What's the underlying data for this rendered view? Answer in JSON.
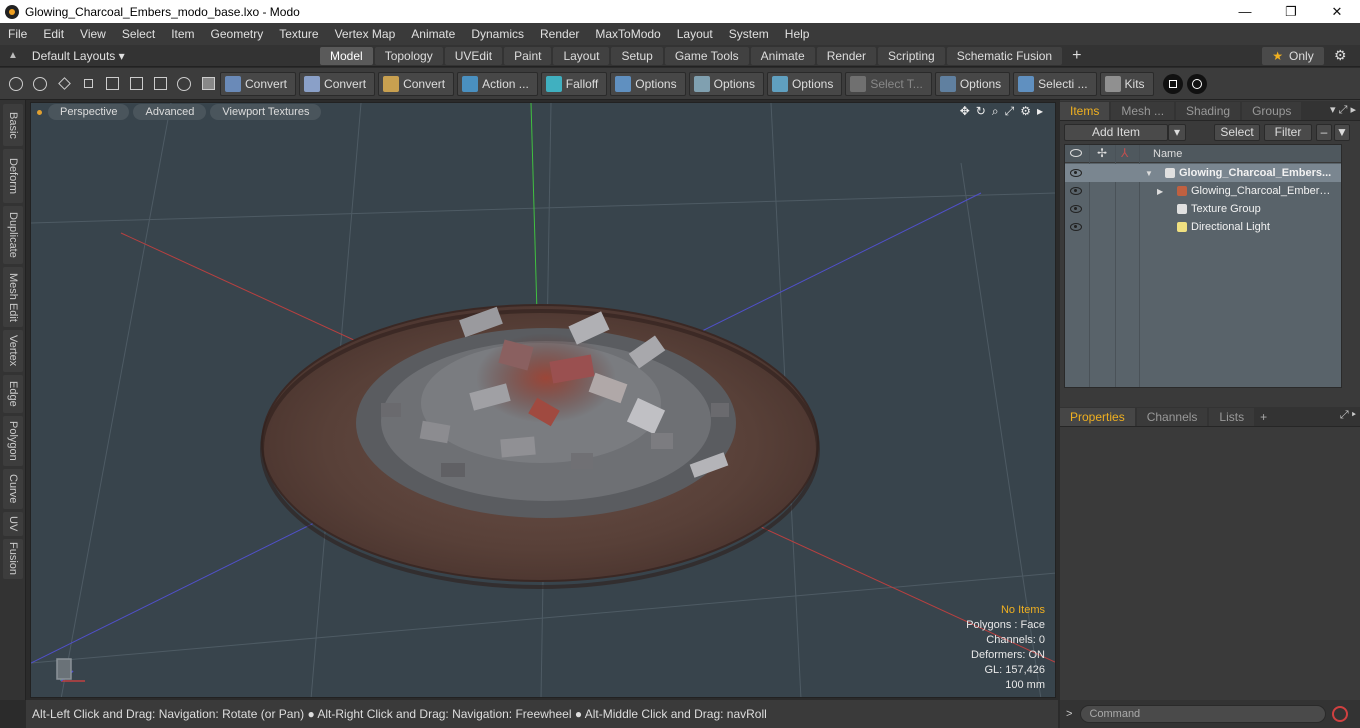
{
  "window": {
    "title": "Glowing_Charcoal_Embers_modo_base.lxo - Modo",
    "minimize": "—",
    "maximize": "❐",
    "close": "✕"
  },
  "menu": [
    "File",
    "Edit",
    "View",
    "Select",
    "Item",
    "Geometry",
    "Texture",
    "Vertex Map",
    "Animate",
    "Dynamics",
    "Render",
    "MaxToModo",
    "Layout",
    "System",
    "Help"
  ],
  "layouts": {
    "label": "Default Layouts ▾",
    "tabs": [
      {
        "label": "Model",
        "active": true
      },
      {
        "label": "Topology",
        "active": false
      },
      {
        "label": "UVEdit",
        "active": false
      },
      {
        "label": "Paint",
        "active": false
      },
      {
        "label": "Layout",
        "active": false
      },
      {
        "label": "Setup",
        "active": false
      },
      {
        "label": "Game Tools",
        "active": false
      },
      {
        "label": "Animate",
        "active": false
      },
      {
        "label": "Render",
        "active": false
      },
      {
        "label": "Scripting",
        "active": false
      },
      {
        "label": "Schematic Fusion",
        "active": false
      }
    ],
    "plus": "+",
    "only_label": "Only",
    "only_star": "★",
    "gear": "⚙"
  },
  "toolbar": {
    "buttons": [
      {
        "label": "Convert",
        "color": "#6a8ab8",
        "dim": false
      },
      {
        "label": "Convert",
        "color": "#8aa0c8",
        "dim": false
      },
      {
        "label": "Convert",
        "color": "#c8a050",
        "dim": false
      },
      {
        "label": "Action ...",
        "color": "#4a90c0",
        "dim": false
      },
      {
        "label": "Falloff",
        "color": "#40b0c0",
        "dim": false
      },
      {
        "label": "Options",
        "color": "#6090c0",
        "dim": false
      },
      {
        "label": "Options",
        "color": "#80a0b0",
        "dim": false
      },
      {
        "label": "Options",
        "color": "#60a0c0",
        "dim": false
      },
      {
        "label": "Select T...",
        "color": "#707070",
        "dim": true
      },
      {
        "label": "Options",
        "color": "#6080a0",
        "dim": false
      },
      {
        "label": "Selecti ...",
        "color": "#6090c0",
        "dim": false
      },
      {
        "label": "Kits",
        "color": "#909090",
        "dim": false
      }
    ]
  },
  "left_tabs": [
    "Basic",
    "Deform",
    "Duplicate",
    "Mesh Edit",
    "Vertex",
    "Edge",
    "Polygon",
    "Curve",
    "UV",
    "Fusion"
  ],
  "viewport": {
    "buttons": [
      "Perspective",
      "Advanced",
      "Viewport Textures"
    ],
    "tools": [
      "✥",
      "↻",
      "⌕",
      "⤢",
      "⚙",
      "▸"
    ],
    "info": {
      "selection": "No Items",
      "polygons": "Polygons : Face",
      "channels": "Channels: 0",
      "deformers": "Deformers: ON",
      "gl": "GL: 157,426",
      "scale": "100 mm"
    }
  },
  "statusbar": {
    "text": "Alt-Left Click and Drag: Navigation: Rotate (or Pan) ● Alt-Right Click and Drag: Navigation: Freewheel ● Alt-Middle Click and Drag: navRoll"
  },
  "items_panel": {
    "tabs": [
      {
        "label": "Items",
        "active": true
      },
      {
        "label": "Mesh ...",
        "active": false
      },
      {
        "label": "Shading",
        "active": false
      },
      {
        "label": "Groups",
        "active": false
      }
    ],
    "add_item": "Add Item",
    "dropdown": "▾",
    "select": "Select",
    "filter": "Filter",
    "name_col": "Name",
    "rows": [
      {
        "label": "Glowing_Charcoal_Embers...",
        "bold": true
      },
      {
        "label": "Glowing_Charcoal_Embers_ ...",
        "bold": false
      },
      {
        "label": "Texture Group",
        "bold": false
      },
      {
        "label": "Directional Light",
        "bold": false
      }
    ]
  },
  "props_panel": {
    "tabs": [
      {
        "label": "Properties",
        "active": true
      },
      {
        "label": "Channels",
        "active": false
      },
      {
        "label": "Lists",
        "active": false
      }
    ],
    "plus": "+"
  },
  "command": {
    "prompt": ">",
    "placeholder": "Command"
  }
}
